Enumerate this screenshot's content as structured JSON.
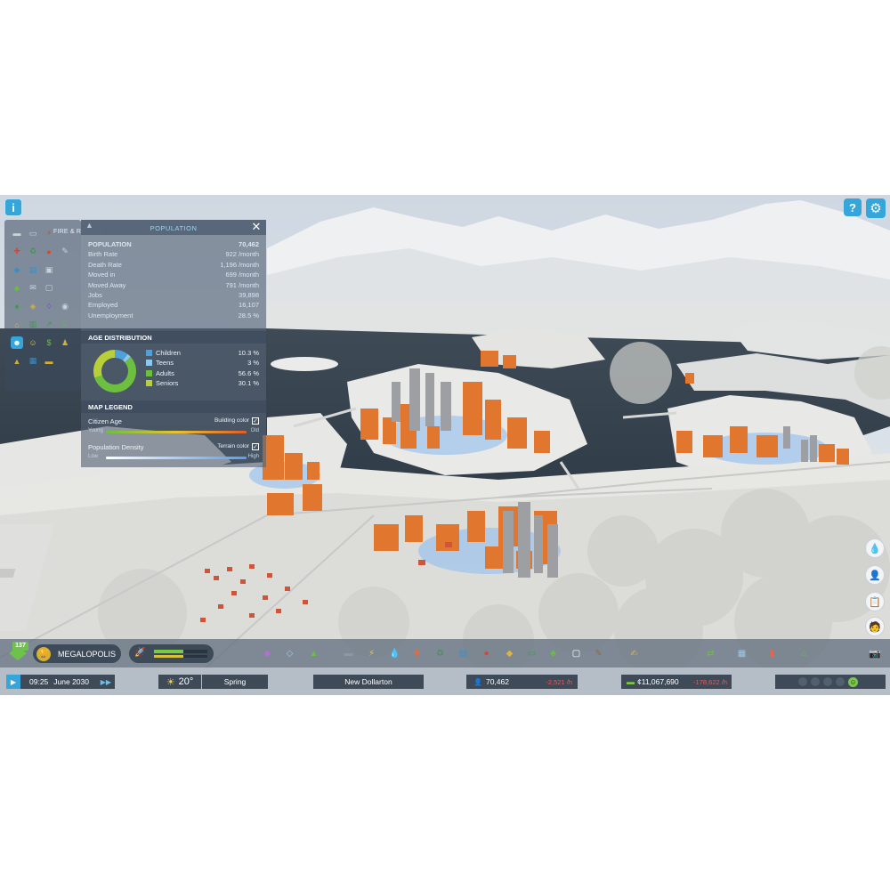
{
  "colors": {
    "accent": "#36a6da",
    "children": "#4fa0d9",
    "teens": "#8ec8ec",
    "adults": "#6cbf3f",
    "seniors": "#b9cf39",
    "building_age_gradient": [
      "#6cbf3f",
      "#e8c32f",
      "#e45c2a"
    ],
    "density_gradient": [
      "#ffffff",
      "#5b9ee8"
    ]
  },
  "top_right": {
    "help_icon": "help-icon",
    "settings_icon": "gear-icon"
  },
  "infoviews": {
    "title": "FIRE & RESCUE",
    "icons": [
      "road-icon",
      "bus-icon",
      "fire-rescue-icon",
      "blank",
      "health-icon",
      "recycle-icon",
      "crime-icon",
      "wrench-icon",
      "police-icon",
      "school-icon",
      "library-icon",
      "blank",
      "park-icon",
      "mail-icon",
      "chat-icon",
      "blank",
      "tree-icon",
      "pollution-icon",
      "land-value-icon",
      "noise-icon",
      "zoning-icon",
      "building-icon",
      "progress-icon",
      "leaf-icon",
      "population-icon",
      "happiness-icon",
      "money-icon",
      "workers-icon",
      "terrain-icon",
      "industry-icon",
      "cars-icon",
      "blank"
    ]
  },
  "population_panel": {
    "title": "POPULATION",
    "stats": [
      {
        "label": "POPULATION",
        "value": "70,462"
      },
      {
        "label": "Birth Rate",
        "value": "922 /month"
      },
      {
        "label": "Death Rate",
        "value": "1,196 /month"
      },
      {
        "label": "Moved in",
        "value": "699 /month"
      },
      {
        "label": "Moved Away",
        "value": "791 /month"
      },
      {
        "label": "Jobs",
        "value": "39,898"
      },
      {
        "label": "Employed",
        "value": "16,107"
      },
      {
        "label": "Unemployment",
        "value": "28.5 %"
      }
    ],
    "age_title": "AGE DISTRIBUTION",
    "age": [
      {
        "label": "Children",
        "value": "10.3 %",
        "pct": 10.3
      },
      {
        "label": "Teens",
        "value": "3 %",
        "pct": 3
      },
      {
        "label": "Adults",
        "value": "56.6 %",
        "pct": 56.6
      },
      {
        "label": "Seniors",
        "value": "30.1 %",
        "pct": 30.1
      }
    ],
    "legend_title": "MAP LEGEND",
    "citizen_age": {
      "label": "Citizen Age",
      "toggle": "Building color",
      "lo": "Young",
      "hi": "Old"
    },
    "pop_density": {
      "label": "Population Density",
      "toggle": "Terrain color",
      "lo": "Low",
      "hi": "High"
    }
  },
  "right_buttons": [
    "water-icon",
    "citizen-icon",
    "clipboard-icon",
    "advisor-icon"
  ],
  "toolbar": {
    "milestone_count": "137",
    "milestone_name": "MEGALOPOLIS",
    "xp_fill_primary": 0.55,
    "xp_fill_secondary": 0.55,
    "tools": [
      "zoning-tool-icon",
      "area-tool-icon",
      "landscaping-tool-icon",
      "road-tool-icon",
      "electricity-tool-icon",
      "water-tool-icon",
      "health-tool-icon",
      "garbage-tool-icon",
      "education-tool-icon",
      "fire-tool-icon",
      "police-tool-icon",
      "transport-tool-icon",
      "parks-tool-icon",
      "communication-tool-icon",
      "landscaping-shovel-icon",
      "signature-tool-icon",
      "money-tool-icon",
      "map-tool-icon",
      "statistics-icon",
      "progression-icon",
      "camera-icon"
    ]
  },
  "statusbar": {
    "time": "09:25",
    "date": "June 2030",
    "temperature": "20°",
    "season": "Spring",
    "city_name": "New Dollarton",
    "population": "70,462",
    "pop_delta": "-2,521 /h",
    "money": "¢11,067,690",
    "money_delta": "-178,622 /h"
  }
}
